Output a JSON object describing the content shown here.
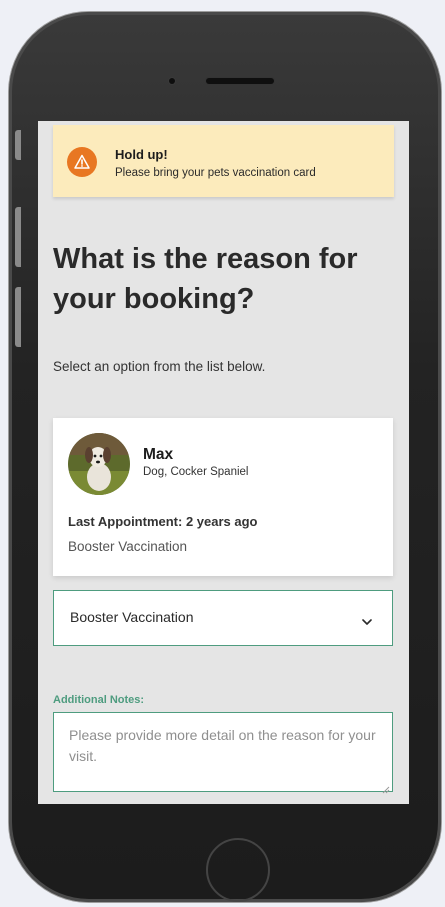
{
  "alert": {
    "title": "Hold up!",
    "message": "Please bring your pets vaccination card",
    "icon": "warning-icon",
    "color": "#fcebbc",
    "icon_color": "#e87722"
  },
  "page": {
    "heading": "What is the reason for your booking?",
    "subtitle": "Select an option from the list below."
  },
  "pet": {
    "name": "Max",
    "breed": "Dog, Cocker Spaniel",
    "last_appointment": "Last Appointment: 2 years ago",
    "last_appointment_type": "Booster Vaccination"
  },
  "reason_select": {
    "value": "Booster Vaccination",
    "icon": "chevron-down-icon"
  },
  "notes": {
    "label": "Additional Notes:",
    "placeholder": "Please provide more detail on the reason for your visit.",
    "value": ""
  },
  "colors": {
    "accent": "#4e9c7f",
    "screen_bg": "#e5e5e5"
  }
}
